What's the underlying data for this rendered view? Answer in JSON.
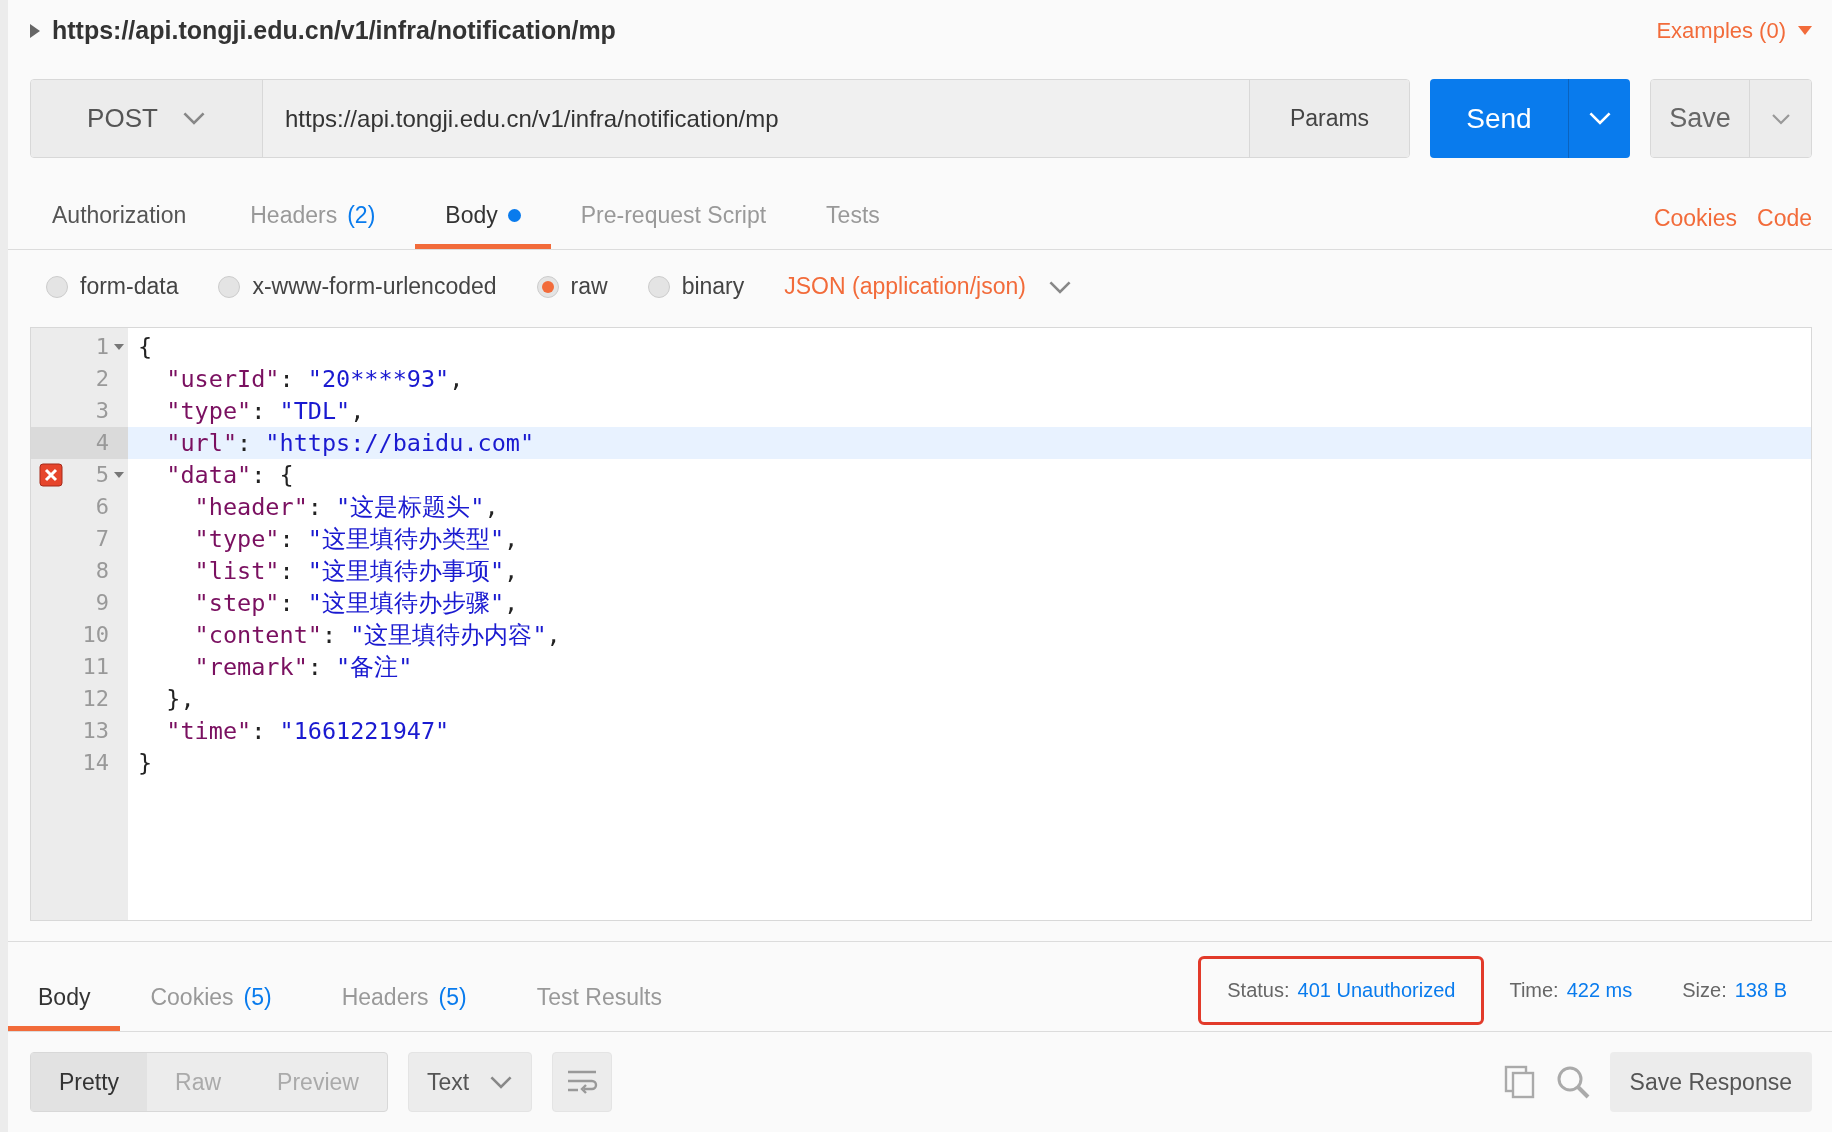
{
  "request": {
    "title": "https://api.tongji.edu.cn/v1/infra/notification/mp",
    "examples": "Examples (0)",
    "method": "POST",
    "url": "https://api.tongji.edu.cn/v1/infra/notification/mp",
    "params": "Params",
    "send": "Send",
    "save": "Save"
  },
  "tabs": [
    {
      "label": "Authorization",
      "selected": false
    },
    {
      "label": "Headers",
      "count": "(2)",
      "selected": false
    },
    {
      "label": "Body",
      "dot": true,
      "selected": true
    },
    {
      "label": "Pre-request Script",
      "selected": false
    },
    {
      "label": "Tests",
      "selected": false
    }
  ],
  "links": [
    "Cookies",
    "Code"
  ],
  "body_types": [
    {
      "label": "form-data",
      "selected": false
    },
    {
      "label": "x-www-form-urlencoded",
      "selected": false
    },
    {
      "label": "raw",
      "selected": true
    },
    {
      "label": "binary",
      "selected": false
    }
  ],
  "content_type": "JSON (application/json)",
  "editor": {
    "lines": [
      {
        "number": "1",
        "foldable": true,
        "error": false,
        "highlighted": false,
        "tokens": [
          {
            "kind": "punct",
            "text": "{"
          }
        ]
      },
      {
        "number": "2",
        "foldable": false,
        "error": false,
        "highlighted": false,
        "tokens": [
          {
            "kind": "key",
            "text": "  \"userId\""
          },
          {
            "kind": "punct",
            "text": ": "
          },
          {
            "kind": "str",
            "text": "\"20****93\""
          },
          {
            "kind": "punct",
            "text": ","
          }
        ]
      },
      {
        "number": "3",
        "foldable": false,
        "error": false,
        "highlighted": false,
        "tokens": [
          {
            "kind": "key",
            "text": "  \"type\""
          },
          {
            "kind": "punct",
            "text": ": "
          },
          {
            "kind": "str",
            "text": "\"TDL\""
          },
          {
            "kind": "punct",
            "text": ","
          }
        ]
      },
      {
        "number": "4",
        "foldable": false,
        "error": false,
        "highlighted": true,
        "tokens": [
          {
            "kind": "key",
            "text": "  \"url\""
          },
          {
            "kind": "punct",
            "text": ": "
          },
          {
            "kind": "str",
            "text": "\"https://baidu.com\""
          }
        ]
      },
      {
        "number": "5",
        "foldable": true,
        "error": true,
        "highlighted": false,
        "tokens": [
          {
            "kind": "key",
            "text": "  \"data\""
          },
          {
            "kind": "punct",
            "text": ": {"
          }
        ]
      },
      {
        "number": "6",
        "foldable": false,
        "error": false,
        "highlighted": false,
        "tokens": [
          {
            "kind": "key",
            "text": "    \"header\""
          },
          {
            "kind": "punct",
            "text": ": "
          },
          {
            "kind": "str",
            "text": "\"这是标题头\""
          },
          {
            "kind": "punct",
            "text": ","
          }
        ]
      },
      {
        "number": "7",
        "foldable": false,
        "error": false,
        "highlighted": false,
        "tokens": [
          {
            "kind": "key",
            "text": "    \"type\""
          },
          {
            "kind": "punct",
            "text": ": "
          },
          {
            "kind": "str",
            "text": "\"这里填待办类型\""
          },
          {
            "kind": "punct",
            "text": ","
          }
        ]
      },
      {
        "number": "8",
        "foldable": false,
        "error": false,
        "highlighted": false,
        "tokens": [
          {
            "kind": "key",
            "text": "    \"list\""
          },
          {
            "kind": "punct",
            "text": ": "
          },
          {
            "kind": "str",
            "text": "\"这里填待办事项\""
          },
          {
            "kind": "punct",
            "text": ","
          }
        ]
      },
      {
        "number": "9",
        "foldable": false,
        "error": false,
        "highlighted": false,
        "tokens": [
          {
            "kind": "key",
            "text": "    \"step\""
          },
          {
            "kind": "punct",
            "text": ": "
          },
          {
            "kind": "str",
            "text": "\"这里填待办步骤\""
          },
          {
            "kind": "punct",
            "text": ","
          }
        ]
      },
      {
        "number": "10",
        "foldable": false,
        "error": false,
        "highlighted": false,
        "tokens": [
          {
            "kind": "key",
            "text": "    \"content\""
          },
          {
            "kind": "punct",
            "text": ": "
          },
          {
            "kind": "str",
            "text": "\"这里填待办内容\""
          },
          {
            "kind": "punct",
            "text": ","
          }
        ]
      },
      {
        "number": "11",
        "foldable": false,
        "error": false,
        "highlighted": false,
        "tokens": [
          {
            "kind": "key",
            "text": "    \"remark\""
          },
          {
            "kind": "punct",
            "text": ": "
          },
          {
            "kind": "str",
            "text": "\"备注\""
          }
        ]
      },
      {
        "number": "12",
        "foldable": false,
        "error": false,
        "highlighted": false,
        "tokens": [
          {
            "kind": "punct",
            "text": "  },"
          }
        ]
      },
      {
        "number": "13",
        "foldable": false,
        "error": false,
        "highlighted": false,
        "tokens": [
          {
            "kind": "key",
            "text": "  \"time\""
          },
          {
            "kind": "punct",
            "text": ": "
          },
          {
            "kind": "str",
            "text": "\"1661221947\""
          }
        ]
      },
      {
        "number": "14",
        "foldable": false,
        "error": false,
        "highlighted": false,
        "tokens": [
          {
            "kind": "punct",
            "text": "}"
          }
        ]
      }
    ]
  },
  "response": {
    "tabs": [
      {
        "label": "Body",
        "selected": true
      },
      {
        "label": "Cookies",
        "count": "(5)",
        "selected": false
      },
      {
        "label": "Headers",
        "count": "(5)",
        "selected": false
      },
      {
        "label": "Test Results",
        "selected": false
      }
    ],
    "stats": [
      {
        "label": "Status:",
        "value": "401 Unauthorized",
        "flagged": true
      },
      {
        "label": "Time:",
        "value": "422 ms",
        "flagged": false
      },
      {
        "label": "Size:",
        "value": "138 B",
        "flagged": false
      }
    ],
    "views": [
      {
        "label": "Pretty",
        "selected": true
      },
      {
        "label": "Raw",
        "selected": false
      },
      {
        "label": "Preview",
        "selected": false
      }
    ],
    "format": "Text",
    "save_response": "Save Response"
  }
}
